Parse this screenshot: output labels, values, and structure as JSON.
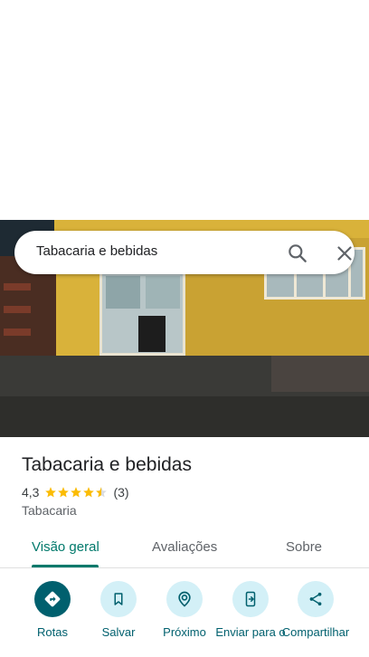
{
  "search": {
    "query": "Tabacaria e bebidas"
  },
  "place": {
    "title": "Tabacaria e bebidas",
    "rating": "4,3",
    "rating_value": 4.3,
    "rating_max": 5,
    "review_count": "(3)",
    "category": "Tabacaria"
  },
  "tabs": [
    {
      "label": "Visão geral",
      "active": true
    },
    {
      "label": "Avaliações",
      "active": false
    },
    {
      "label": "Sobre",
      "active": false
    }
  ],
  "actions": [
    {
      "label": "Rotas",
      "icon": "directions-icon"
    },
    {
      "label": "Salvar",
      "icon": "bookmark-icon"
    },
    {
      "label": "Próximo",
      "icon": "nearby-icon"
    },
    {
      "label": "Enviar para o",
      "icon": "send-to-phone-icon"
    },
    {
      "label": "Compartilhar",
      "icon": "share-icon"
    }
  ],
  "colors": {
    "accent": "#00796b",
    "action_primary": "#00606e",
    "action_bg": "#d3f0f7",
    "star": "#fbbc04"
  }
}
